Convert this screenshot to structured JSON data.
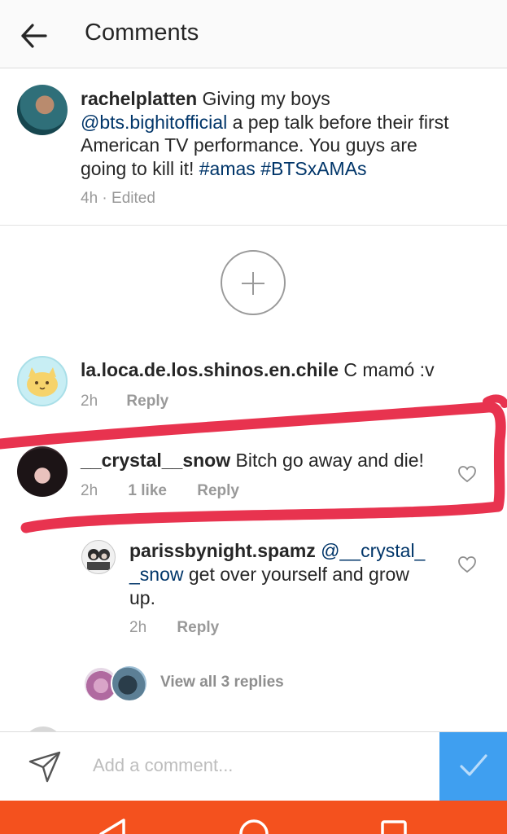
{
  "header": {
    "title": "Comments",
    "back_icon": "arrow-left-icon"
  },
  "caption": {
    "username": "rachelplatten",
    "text_before": "Giving my boys",
    "mention": "@bts.bighitofficial",
    "text_after": "a pep talk before their first American TV performance. You guys are going to kill it!",
    "hashtag_1": "#amas",
    "hashtag_2": "#BTSxAMAs",
    "time": "4h",
    "separator": "·",
    "edited": "Edited"
  },
  "load_more_icon": "plus-circle-icon",
  "comments": [
    {
      "username": "la.loca.de.los.shinos.en.chile",
      "text": "C mamó :v",
      "time": "2h",
      "reply": "Reply"
    },
    {
      "username": "__crystal__snow",
      "text": "Bitch go away and die!",
      "time": "2h",
      "likes": "1 like",
      "reply": "Reply",
      "like_icon": "heart-outline-icon"
    }
  ],
  "reply_comment": {
    "username": "parissbynight.spamz",
    "mention": "@__crystal__snow",
    "text": "get over yourself and grow up.",
    "time": "2h",
    "reply": "Reply",
    "like_icon": "heart-outline-icon"
  },
  "view_replies": "View all 3 replies",
  "composer": {
    "placeholder": "Add a comment...",
    "send_icon": "paper-plane-icon",
    "post_icon": "checkmark-icon"
  },
  "nav": {
    "back_icon": "triangle-back-icon",
    "home_icon": "circle-home-icon",
    "recents_icon": "square-recents-icon"
  },
  "colors": {
    "link": "#003569",
    "annotation": "#e8334f",
    "post_button": "#3f9ff0",
    "navbar": "#f4511e"
  }
}
